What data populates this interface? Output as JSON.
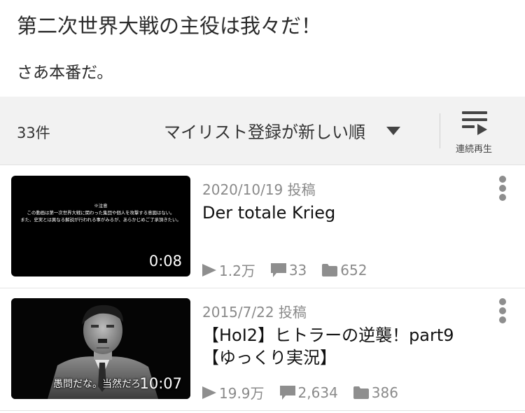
{
  "mylist": {
    "title": "第二次世界大戦の主役は我々だ！",
    "description": "さあ本番だ。"
  },
  "toolbar": {
    "count": "33件",
    "sort_selected": "マイリスト登録が新しい順",
    "continuous_play_label": "連続再生"
  },
  "videos": [
    {
      "posted": "2020/10/19 投稿",
      "title": "Der totale Krieg",
      "duration": "0:08",
      "thumbnail_notice": [
        "※注意",
        "この動画は第一次世界大戦に関わった集団や個人を攻撃する意図はない。",
        "また、史実とは異なる解説が行われる事がみるが、あらかじめご了承頂きたい。"
      ],
      "thumbnail_caption": "",
      "views": "1.2万",
      "comments": "33",
      "mylists": "652"
    },
    {
      "posted": "2015/7/22 投稿",
      "title": "【HoI2】ヒトラーの逆襲！part9【ゆっくり実況】",
      "duration": "10:07",
      "thumbnail_notice": [],
      "thumbnail_caption": "愚問だな。当然だろ",
      "views": "19.9万",
      "comments": "2,634",
      "mylists": "386"
    }
  ],
  "icons": {
    "play": "play-icon",
    "comment": "comment-icon",
    "folder": "folder-icon",
    "more": "more-vertical-icon",
    "continuous": "continuous-play-icon",
    "caret": "chevron-down-icon"
  },
  "colors": {
    "toolbar_bg": "#f2f2f2",
    "meta_gray": "#8a8a8a",
    "thumb_bg": "#000000"
  }
}
